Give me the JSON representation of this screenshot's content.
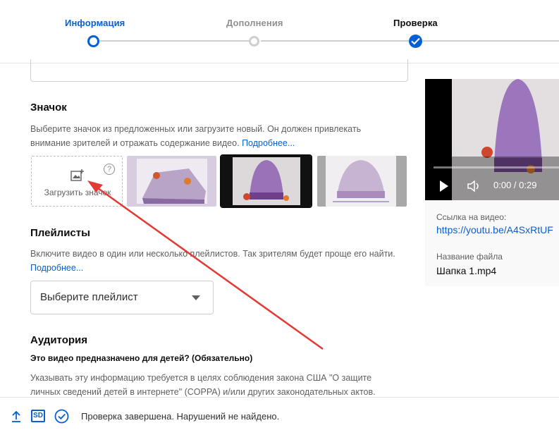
{
  "stepper": {
    "steps": [
      {
        "label": "Информация",
        "state": "active"
      },
      {
        "label": "Дополнения",
        "state": "pending"
      },
      {
        "label": "Проверка",
        "state": "done"
      }
    ]
  },
  "thumbnail_section": {
    "title": "Значок",
    "description": "Выберите значок из предложенных или загрузите новый. Он должен привлекать внимание зрителей и отражать содержание видео.",
    "more_link": "Подробнее...",
    "upload_label": "Загрузить значок",
    "help_icon": "?",
    "selected_thumbnail_index": 1
  },
  "playlist_section": {
    "title": "Плейлисты",
    "description": "Включите видео в один или несколько плейлистов. Так зрителям будет проще его найти.",
    "more_link": "Подробнее...",
    "select_value": "Выберите плейлист"
  },
  "audience_section": {
    "title": "Аудитория",
    "question": "Это видео предназначено для детей? (Обязательно)",
    "text": "Указывать эту информацию требуется в целях соблюдения закона США \"О защите личных сведений детей в интернете\" (COPPA) и/или других законодательных актов."
  },
  "video_card": {
    "time": "0:00 / 0:29",
    "progress": 0.0,
    "link_label": "Ссылка на видео:",
    "link_value": "https://youtu.be/A4SxRtUF",
    "filename_label": "Название файла",
    "filename_value": "Шапка 1.mp4"
  },
  "footer": {
    "quality_badge": "SD",
    "status": "Проверка завершена. Нарушений не найдено."
  },
  "colors": {
    "accent": "#065fd4",
    "annotation_arrow": "#e53935"
  }
}
